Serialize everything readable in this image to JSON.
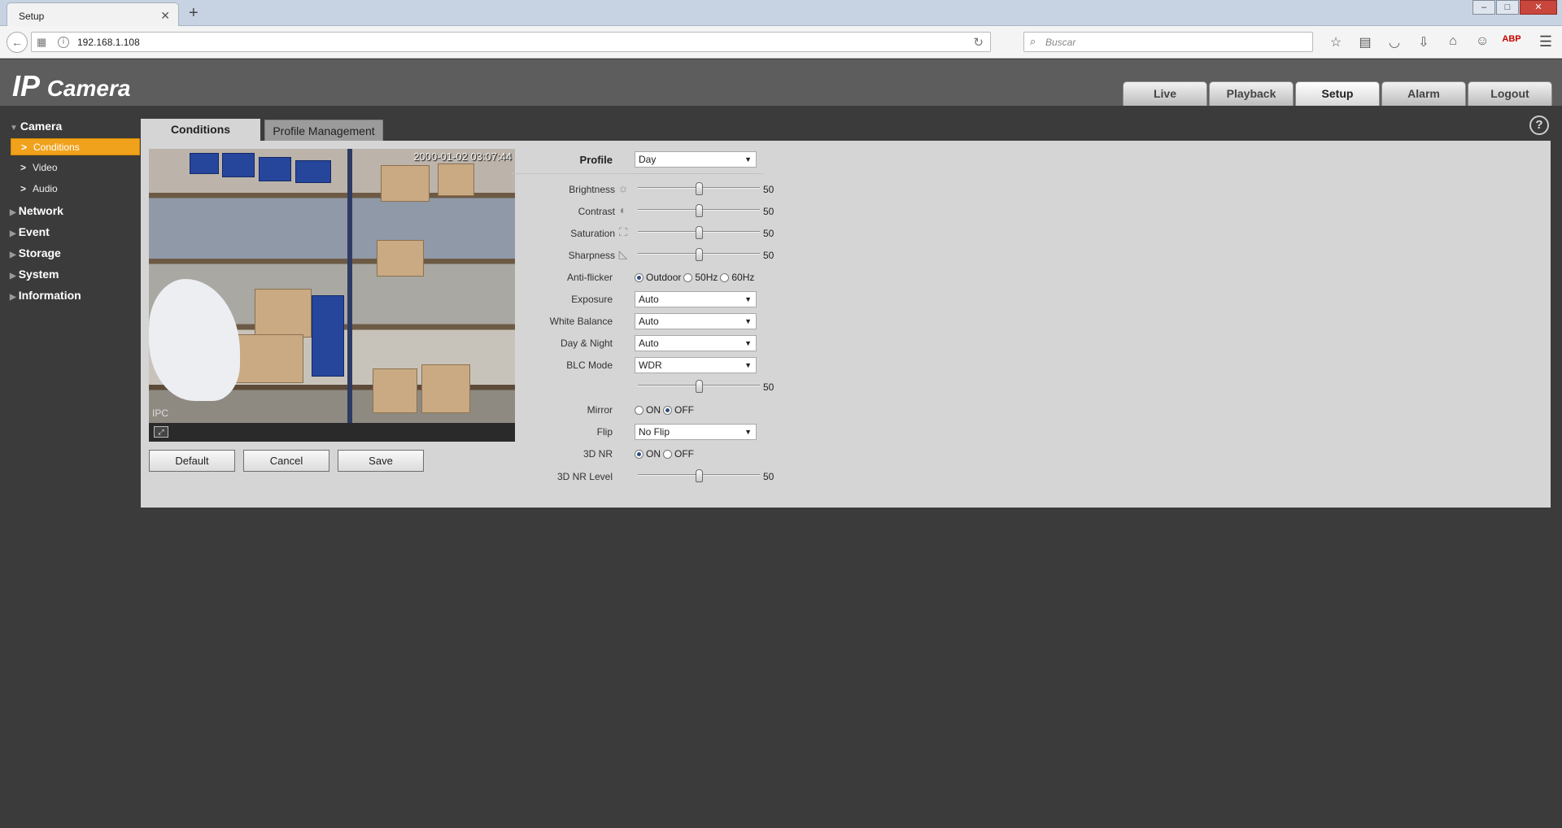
{
  "browser": {
    "tab_title": "Setup",
    "tab_close": "✕",
    "new_tab": "+",
    "url": "192.168.1.108",
    "search_placeholder": "Buscar",
    "abp": "ABP"
  },
  "header": {
    "logo_main": "IP",
    "logo_sub": "Camera",
    "nav": [
      {
        "label": "Live"
      },
      {
        "label": "Playback"
      },
      {
        "label": "Setup",
        "active": true
      },
      {
        "label": "Alarm"
      },
      {
        "label": "Logout"
      }
    ]
  },
  "sidebar": {
    "camera": "Camera",
    "conditions": "Conditions",
    "video": "Video",
    "audio": "Audio",
    "network": "Network",
    "event": "Event",
    "storage": "Storage",
    "system": "System",
    "information": "Information"
  },
  "tabs": {
    "conditions": "Conditions",
    "profile_management": "Profile Management"
  },
  "video": {
    "timestamp": "2000-01-02 03:07:44",
    "corner_label": "IPC"
  },
  "buttons": {
    "default": "Default",
    "cancel": "Cancel",
    "save": "Save"
  },
  "settings": {
    "profile_label": "Profile",
    "profile_value": "Day",
    "brightness_label": "Brightness",
    "brightness_value": 50,
    "contrast_label": "Contrast",
    "contrast_value": 50,
    "saturation_label": "Saturation",
    "saturation_value": 50,
    "sharpness_label": "Sharpness",
    "sharpness_value": 50,
    "anti_flicker_label": "Anti-flicker",
    "anti_flicker_options": [
      "Outdoor",
      "50Hz",
      "60Hz"
    ],
    "anti_flicker_selected": "Outdoor",
    "exposure_label": "Exposure",
    "exposure_value": "Auto",
    "white_balance_label": "White Balance",
    "white_balance_value": "Auto",
    "day_night_label": "Day & Night",
    "day_night_value": "Auto",
    "blc_mode_label": "BLC Mode",
    "blc_mode_value": "WDR",
    "wdr_value": 50,
    "mirror_label": "Mirror",
    "mirror_options": [
      "ON",
      "OFF"
    ],
    "mirror_selected": "OFF",
    "flip_label": "Flip",
    "flip_value": "No Flip",
    "nr3d_label": "3D NR",
    "nr3d_options": [
      "ON",
      "OFF"
    ],
    "nr3d_selected": "ON",
    "nr3d_level_label": "3D NR Level",
    "nr3d_level_value": 50
  },
  "colors": {
    "active_sidebar": "#f0a21c",
    "header_bg": "#5d5d5d",
    "panel_bg": "#d5d5d5"
  }
}
